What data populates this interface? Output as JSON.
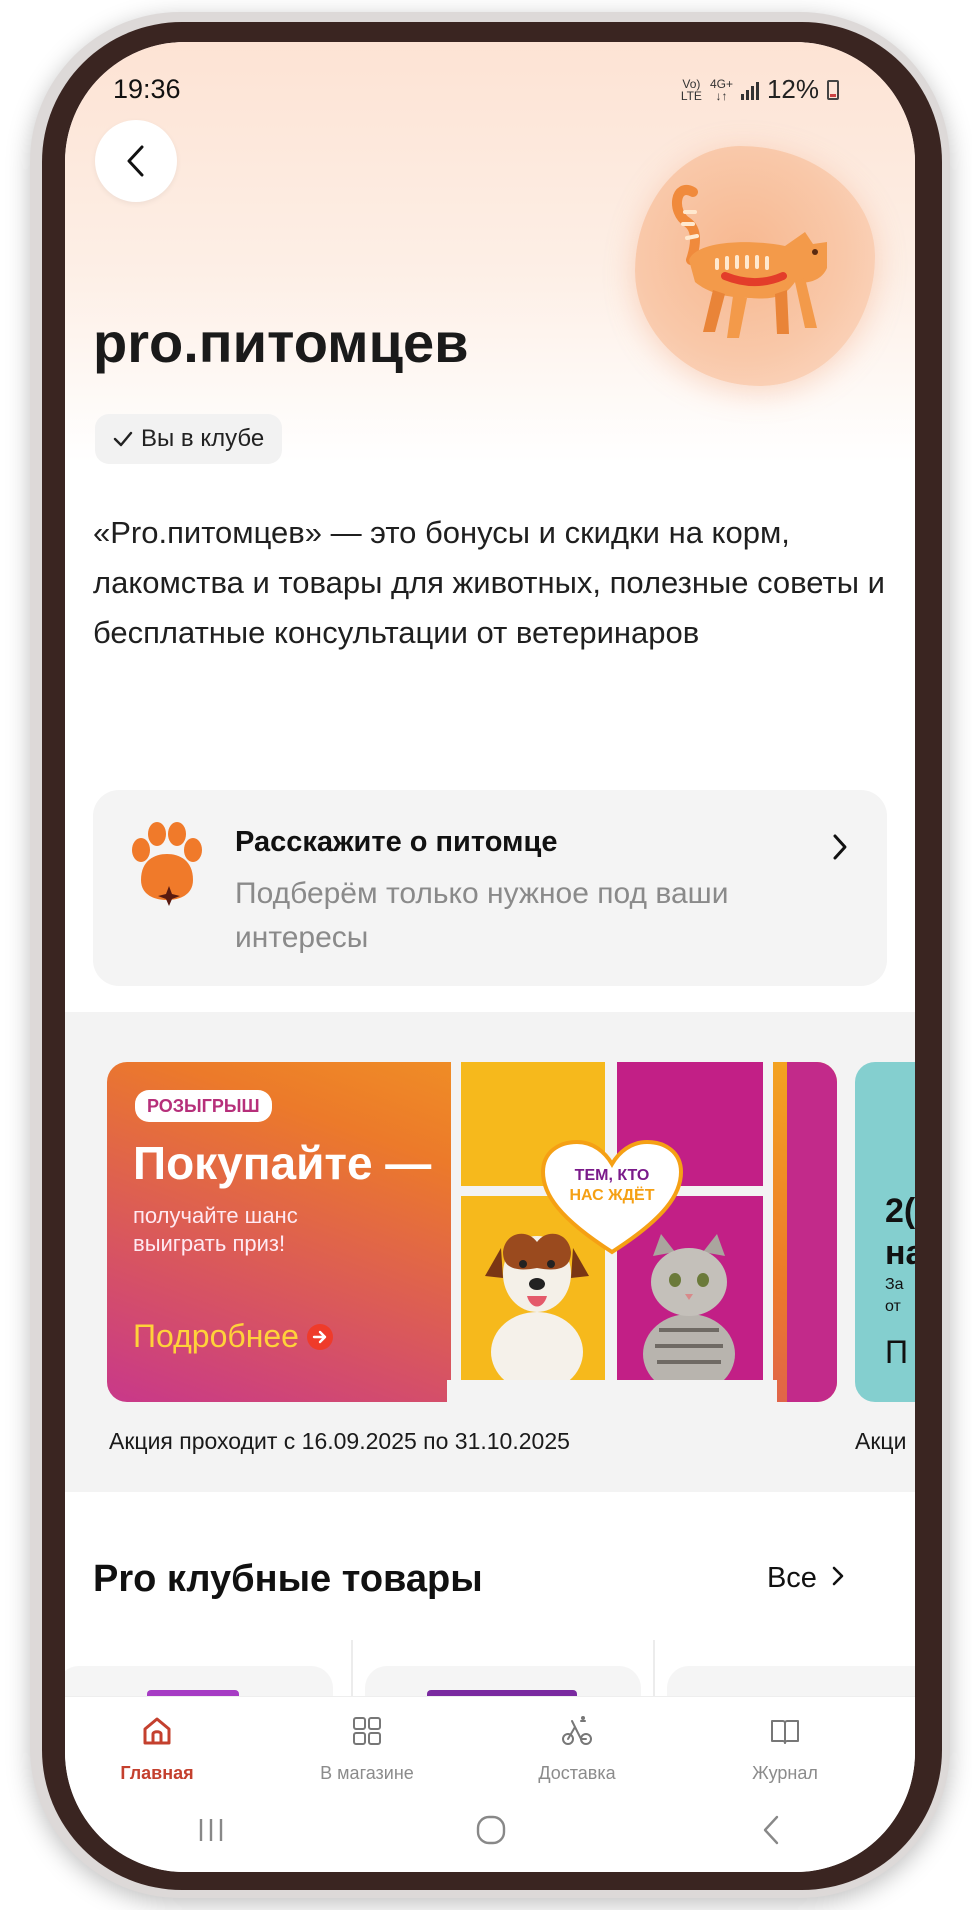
{
  "status_bar": {
    "time": "19:36",
    "network_top": "Vo)",
    "network_bottom": "LTE",
    "network2_top": "4G+",
    "network2_bottom": "↓↑",
    "battery": "12%"
  },
  "header": {
    "back_icon": "chevron-left-icon",
    "title": "pro.питомцев",
    "membership_badge": "Вы в клубе",
    "badge_icon": "check-icon",
    "illustration": "cat-icon"
  },
  "description": "«Pro.питомцев» — это бонусы и скидки на корм, лакомства и товары для животных, полезные советы и бесплатные консультации от ветеринаров",
  "pet_card": {
    "icon": "paw-icon",
    "title": "Расскажите о питомце",
    "subtitle": "Подберём только нужное под ваши интересы"
  },
  "promos": [
    {
      "tag": "РОЗЫГРЫШ",
      "headline": "Покупайте —",
      "subline": "получайте шанс выиграть приз!",
      "cta": "Подробнее",
      "heart_line1": "ТЕМ, КТО",
      "heart_line2": "НАС ЖДЁТ",
      "caption": "Акция проходит с 16.09.2025 по 31.10.2025"
    },
    {
      "line1": "2(",
      "line2": "на",
      "line3": "За",
      "line4": "от",
      "line5": "П",
      "caption": "Акци"
    }
  ],
  "club_products": {
    "title": "Pro клубные товары",
    "see_all": "Все"
  },
  "tabs": [
    {
      "label": "Главная",
      "icon": "home-icon",
      "active": true
    },
    {
      "label": "В магазине",
      "icon": "grid-icon",
      "active": false
    },
    {
      "label": "Доставка",
      "icon": "delivery-icon",
      "active": false
    },
    {
      "label": "Журнал",
      "icon": "book-icon",
      "active": false
    }
  ],
  "system_nav": [
    "recent-apps-icon",
    "home-circle-icon",
    "back-icon"
  ],
  "colors": {
    "accent": "#c4402e",
    "promo_orange": "#ec7a2a",
    "promo_magenta": "#c8388a",
    "cta_yellow": "#ffd23a"
  }
}
